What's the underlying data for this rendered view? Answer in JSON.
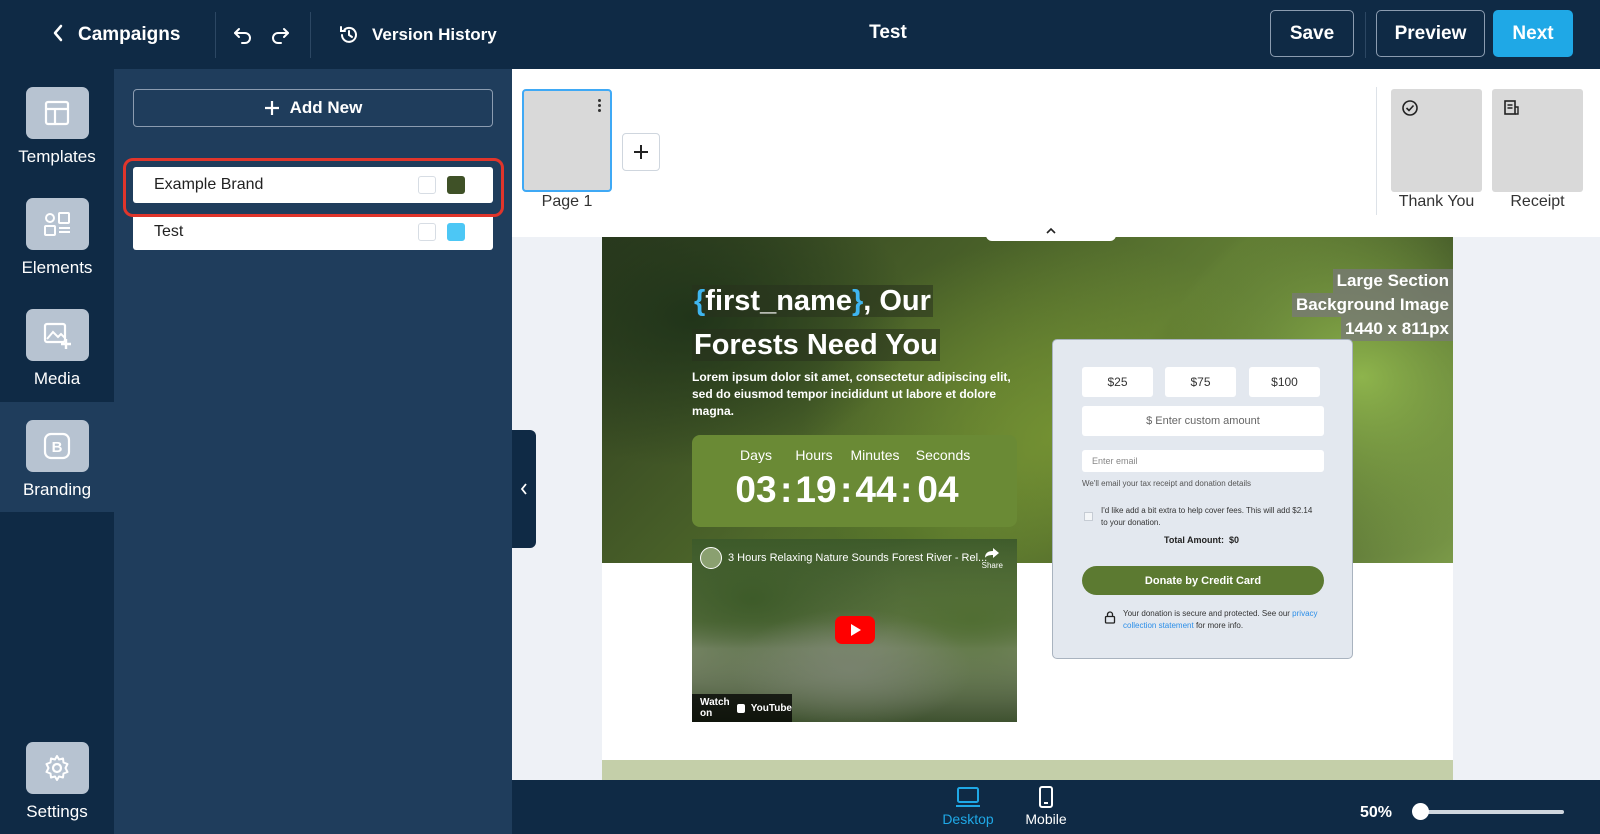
{
  "topbar": {
    "back_label": "Campaigns",
    "version_history_label": "Version History",
    "title": "Test",
    "save_label": "Save",
    "preview_label": "Preview",
    "next_label": "Next"
  },
  "rail": {
    "items": [
      {
        "label": "Templates",
        "icon": "layout-icon"
      },
      {
        "label": "Elements",
        "icon": "elements-icon"
      },
      {
        "label": "Media",
        "icon": "add-image-icon"
      },
      {
        "label": "Branding",
        "icon": "brand-icon",
        "active": true
      },
      {
        "label": "Settings",
        "icon": "gear-icon"
      }
    ]
  },
  "branding": {
    "add_new_label": "Add New",
    "brands": [
      {
        "name": "Example Brand",
        "primary_color": "#3f5127",
        "selected": true
      },
      {
        "name": "Test",
        "primary_color": "#4cc7f5",
        "selected": false
      }
    ]
  },
  "pages": {
    "items": [
      {
        "label": "Page 1",
        "active": true
      }
    ],
    "end_pages": [
      {
        "label": "Thank You",
        "icon": "check-circle-icon"
      },
      {
        "label": "Receipt",
        "icon": "receipt-icon"
      }
    ]
  },
  "hero": {
    "brace_open": "{",
    "merge_field": "first_name",
    "brace_close": "}",
    "headline_rest": ", Our",
    "headline_line2": "Forests Need You",
    "body": "Lorem ipsum dolor sit amet, consectetur adipiscing elit, sed do eiusmod tempor incididunt ut labore et dolore magna.",
    "size_tag": [
      "Large Section",
      "Background Image",
      "1440 x 811px"
    ]
  },
  "countdown": {
    "labels": [
      "Days",
      "Hours",
      "Minutes",
      "Seconds"
    ],
    "values": [
      "03",
      "19",
      "44",
      "04"
    ],
    "separator": ":"
  },
  "video": {
    "title": "3 Hours Relaxing Nature Sounds Forest River - Rel...",
    "share_label": "Share",
    "watch_on": "Watch on",
    "platform": "YouTube"
  },
  "donation_form": {
    "amounts": [
      "$25",
      "$75",
      "$100"
    ],
    "custom_placeholder": "$ Enter custom amount",
    "email_placeholder": "Enter email",
    "email_note": "We'll email your tax receipt and donation details",
    "fee_text": "I'd like add a bit extra to help cover fees. This will add $2.14 to your donation.",
    "total_label": "Total Amount:",
    "total_value": "$0",
    "donate_label": "Donate by Credit Card",
    "secure_text": "Your donation is secure and protected. See our",
    "privacy_link": "privacy collection statement",
    "secure_tail": "for more info."
  },
  "bottombar": {
    "devices": [
      {
        "label": "Desktop",
        "active": true,
        "color": "#1fa8e6"
      },
      {
        "label": "Mobile",
        "active": false
      }
    ],
    "zoom_label": "50%",
    "zoom_value": 0.5
  }
}
